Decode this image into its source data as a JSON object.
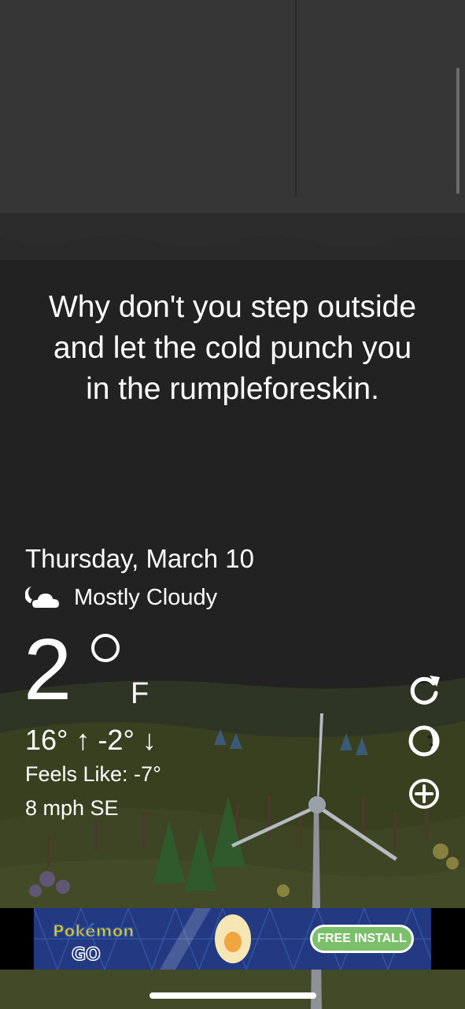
{
  "quote": {
    "lines": [
      "Why don't you step outside",
      "and let the cold punch you",
      "in the rumpleforeskin."
    ]
  },
  "weather": {
    "date": "Thursday, March 10",
    "condition": "Mostly Cloudy",
    "condition_icon": "partly-cloudy-night-icon",
    "temperature": "2",
    "unit": "F",
    "hilo": "16° ↑ -2° ↓",
    "feels_like": "Feels Like: -7°",
    "wind": "8 mph SE"
  },
  "actions": {
    "refresh_icon": "refresh-icon",
    "moon_icon": "moon-phase-icon",
    "add_icon": "add-location-icon"
  },
  "ad": {
    "brand": "Pokémon GO",
    "install_label": "FREE INSTALL",
    "accent": "#233a82",
    "button_color": "#7bbf6a"
  },
  "colors": {
    "background": "#222222",
    "cloud": "#333333",
    "hills": "#3d4524"
  }
}
